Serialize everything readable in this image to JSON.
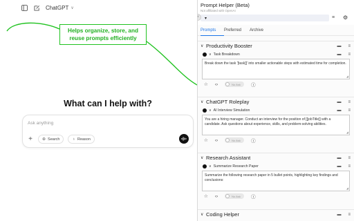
{
  "chatgpt": {
    "model_name": "ChatGPT",
    "heading": "What can I help with?",
    "input_placeholder": "Ask anything",
    "search_label": "Search",
    "reason_label": "Reason"
  },
  "callout": {
    "line1": "Helps organize, store, and",
    "line2": "reuse prompts efficiently",
    "color": "#22b022"
  },
  "panel": {
    "title": "Prompt Helper (Beta)",
    "subtitle": "Not affiliated with OpenAI",
    "tabs": [
      "Prompts",
      "Preferred",
      "Archive"
    ],
    "active_tab": "Prompts",
    "accent": "#1a73e8",
    "toggle_label": "No Ask",
    "sections": [
      {
        "name": "Productivity Booster",
        "prompt_name": "Task Breakdown",
        "prompt_text": "Break down the task '[task]]' into smaller actionable steps with estimated time for completion."
      },
      {
        "name": "ChatGPT Roleplay",
        "prompt_name": "AI Interview Simulation",
        "prompt_text": "You are a hiring manager. Conduct an interview for the position of [[jobTitle]] with a candidate. Ask questions about experience, skills, and problem-solving abilities."
      },
      {
        "name": "Research Assistant",
        "prompt_name": "Summarize Research Paper",
        "prompt_text": "Summarize the following research paper in 5 bullet points, highlighting key findings and conclusions:"
      },
      {
        "name": "Coding Helper"
      }
    ]
  }
}
